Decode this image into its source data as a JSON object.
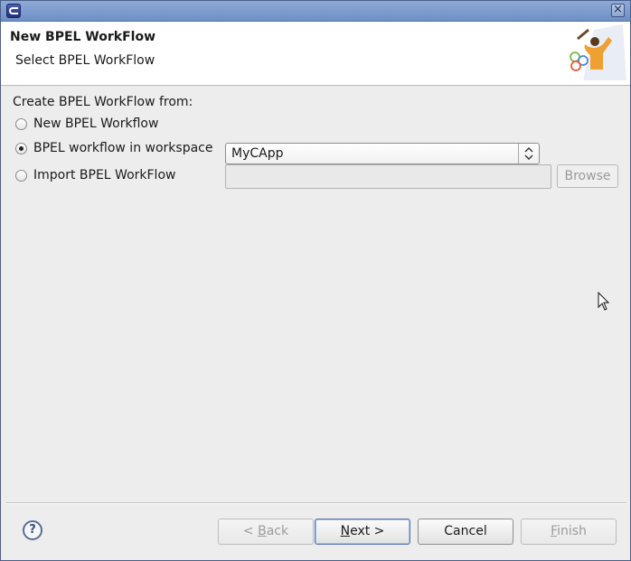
{
  "window": {
    "title": "",
    "close_glyph": "×"
  },
  "banner": {
    "title": "New BPEL WorkFlow",
    "subtitle": "Select BPEL WorkFlow"
  },
  "form": {
    "create_label": "Create BPEL WorkFlow from:",
    "options": [
      {
        "label": "New BPEL Workflow",
        "checked": false
      },
      {
        "label": "BPEL workflow in workspace",
        "checked": true
      },
      {
        "label": "Import BPEL WorkFlow",
        "checked": false
      }
    ],
    "workspace_project": {
      "value": "MyCApp"
    },
    "import_path": {
      "value": "",
      "placeholder": ""
    },
    "browse_label": "Browse"
  },
  "footer": {
    "help_glyph": "?",
    "back": {
      "prefix": "< ",
      "mnemonic": "B",
      "rest": "ack"
    },
    "next": {
      "mnemonic": "N",
      "rest": "ext >"
    },
    "cancel": "Cancel",
    "finish": {
      "mnemonic": "F",
      "rest": "inish"
    }
  },
  "colors": {
    "titlebar": "#7d9bcf",
    "accent": "#5778b8",
    "logo_orange": "#f0a030"
  }
}
